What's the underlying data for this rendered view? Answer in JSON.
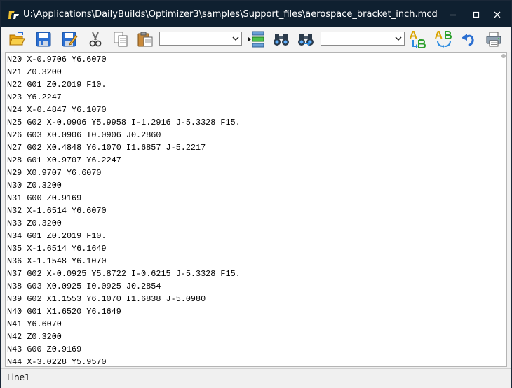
{
  "window": {
    "title": "U:\\Applications\\DailyBuilds\\Optimizer3\\samples\\Support_files\\aerospace_bracket_inch.mcd"
  },
  "toolbar": {
    "combo1_value": "",
    "combo2_value": ""
  },
  "editor": {
    "lines": [
      "N20 X-0.9706 Y6.6070",
      "N21 Z0.3200",
      "N22 G01 Z0.2019 F10.",
      "N23 Y6.2247",
      "N24 X-0.4847 Y6.1070",
      "N25 G02 X-0.0906 Y5.9958 I-1.2916 J-5.3328 F15.",
      "N26 G03 X0.0906 I0.0906 J0.2860",
      "N27 G02 X0.4848 Y6.1070 I1.6857 J-5.2217",
      "N28 G01 X0.9707 Y6.2247",
      "N29 X0.9707 Y6.6070",
      "N30 Z0.3200",
      "N31 G00 Z0.9169",
      "N32 X-1.6514 Y6.6070",
      "N33 Z0.3200",
      "N34 G01 Z0.2019 F10.",
      "N35 X-1.6514 Y6.1649",
      "N36 X-1.1548 Y6.1070",
      "N37 G02 X-0.0925 Y5.8722 I-0.6215 J-5.3328 F15.",
      "N38 G03 X0.0925 I0.0925 J0.2854",
      "N39 G02 X1.1553 Y6.1070 I1.6838 J-5.0980",
      "N40 G01 X1.6520 Y6.1649",
      "N41 Y6.6070",
      "N42 Z0.3200",
      "N43 G00 Z0.9169",
      "N44 X-3.0228 Y5.9570"
    ]
  },
  "status": {
    "text": "Line1"
  }
}
